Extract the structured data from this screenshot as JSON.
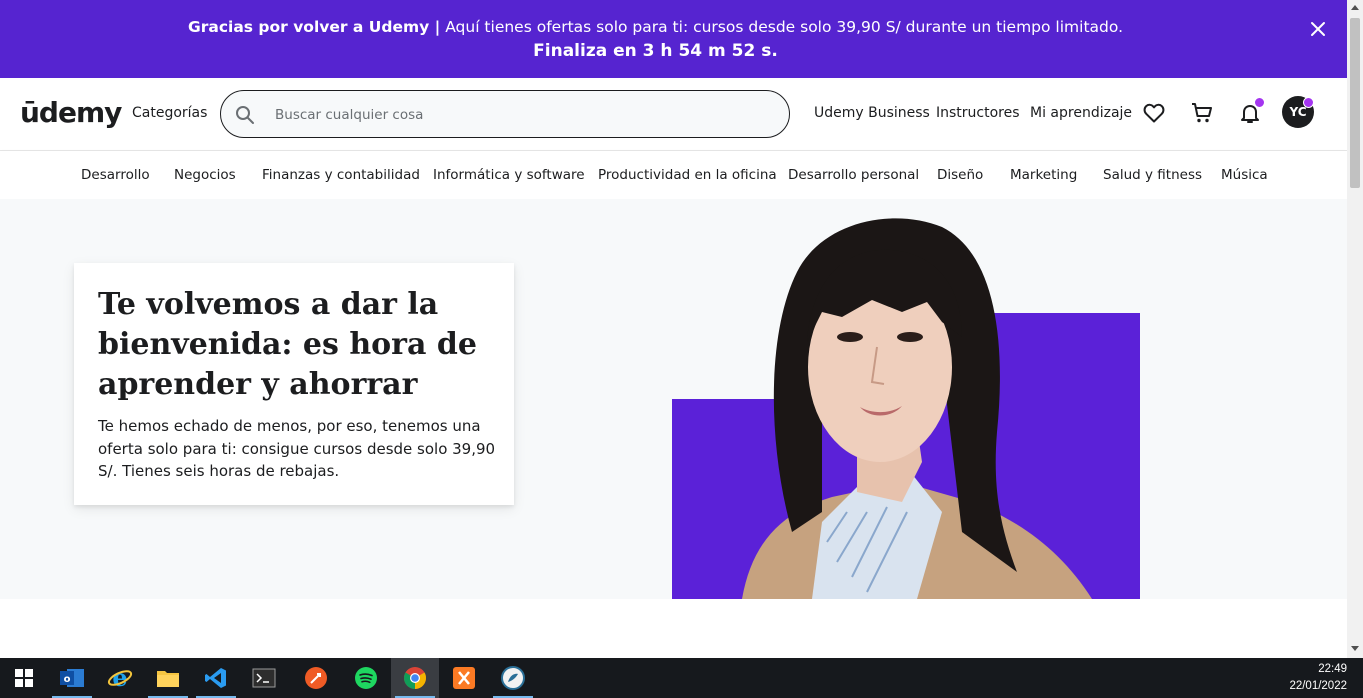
{
  "promo": {
    "bold_text": "Gracias por volver a Udemy |",
    "text": " Aquí tienes ofertas solo para ti: cursos desde solo 39,90 S/ durante un tiempo limitado.",
    "countdown": "Finaliza en 3 h 54 m 52 s."
  },
  "header": {
    "logo": "ūdemy",
    "categories": "Categorías",
    "search_placeholder": "Buscar cualquier cosa",
    "business": "Udemy Business",
    "instructors": "Instructores",
    "my_learning": "Mi aprendizaje",
    "avatar": "YC"
  },
  "nav": {
    "items": [
      "Desarrollo",
      "Negocios",
      "Finanzas y contabilidad",
      "Informática y software",
      "Productividad en la oficina",
      "Desarrollo personal",
      "Diseño",
      "Marketing",
      "Salud y fitness",
      "Música"
    ]
  },
  "hero": {
    "title": "Te volvemos a dar la bienvenida: es hora de aprender y ahorrar",
    "text": "Te hemos echado de menos, por eso, tenemos una oferta solo para ti: consigue cursos desde solo 39,90 S/. Tienes seis horas de rebajas."
  },
  "taskbar": {
    "time": "22:49",
    "date": "22/01/2022",
    "apps": [
      "windows-start",
      "outlook",
      "internet-explorer",
      "file-explorer",
      "vscode",
      "terminal",
      "postman",
      "spotify",
      "chrome",
      "xampp",
      "app"
    ]
  },
  "colors": {
    "brand_purple": "#5624d0",
    "accent_purple": "#a435f0",
    "hero_purple": "#5b21d8"
  }
}
